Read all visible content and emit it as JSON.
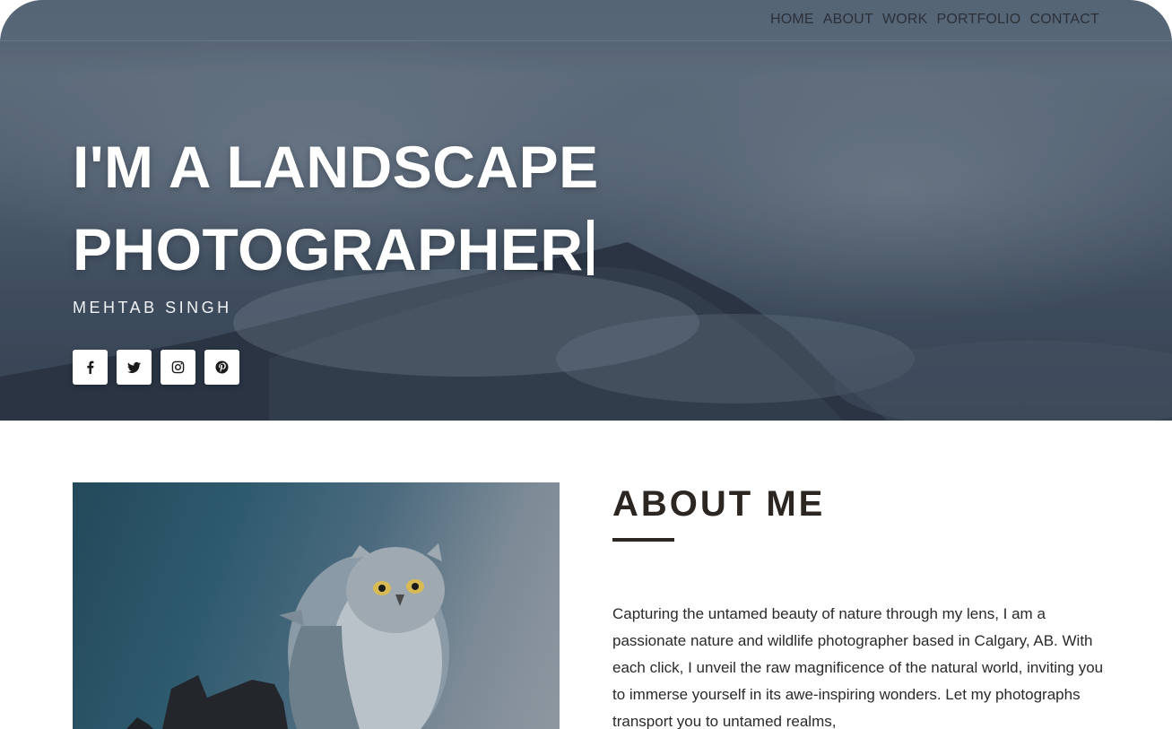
{
  "nav": {
    "items": [
      {
        "label": "HOME"
      },
      {
        "label": "ABOUT"
      },
      {
        "label": "WORK"
      },
      {
        "label": "PORTFOLIO"
      },
      {
        "label": "CONTACT"
      }
    ]
  },
  "hero": {
    "title_line1": "I'M A LANDSCAPE",
    "title_line2": "PHOTOGRAPHER",
    "subtitle": "MEHTAB SINGH",
    "socials": [
      {
        "icon": "facebook-icon"
      },
      {
        "icon": "twitter-icon"
      },
      {
        "icon": "instagram-icon"
      },
      {
        "icon": "pinterest-icon"
      }
    ]
  },
  "about": {
    "title": "ABOUT ME",
    "body": "Capturing the untamed beauty of nature through my lens, I am a passionate nature and wildlife photographer based in Calgary, AB. With each click, I unveil the raw magnificence of the natural world, inviting you to immerse yourself in its awe-inspiring wonders. Let my photographs transport you to untamed realms,"
  },
  "colors": {
    "hero_overlay": "#465566",
    "heading": "#2c2622",
    "nav_text": "#2b3038"
  }
}
